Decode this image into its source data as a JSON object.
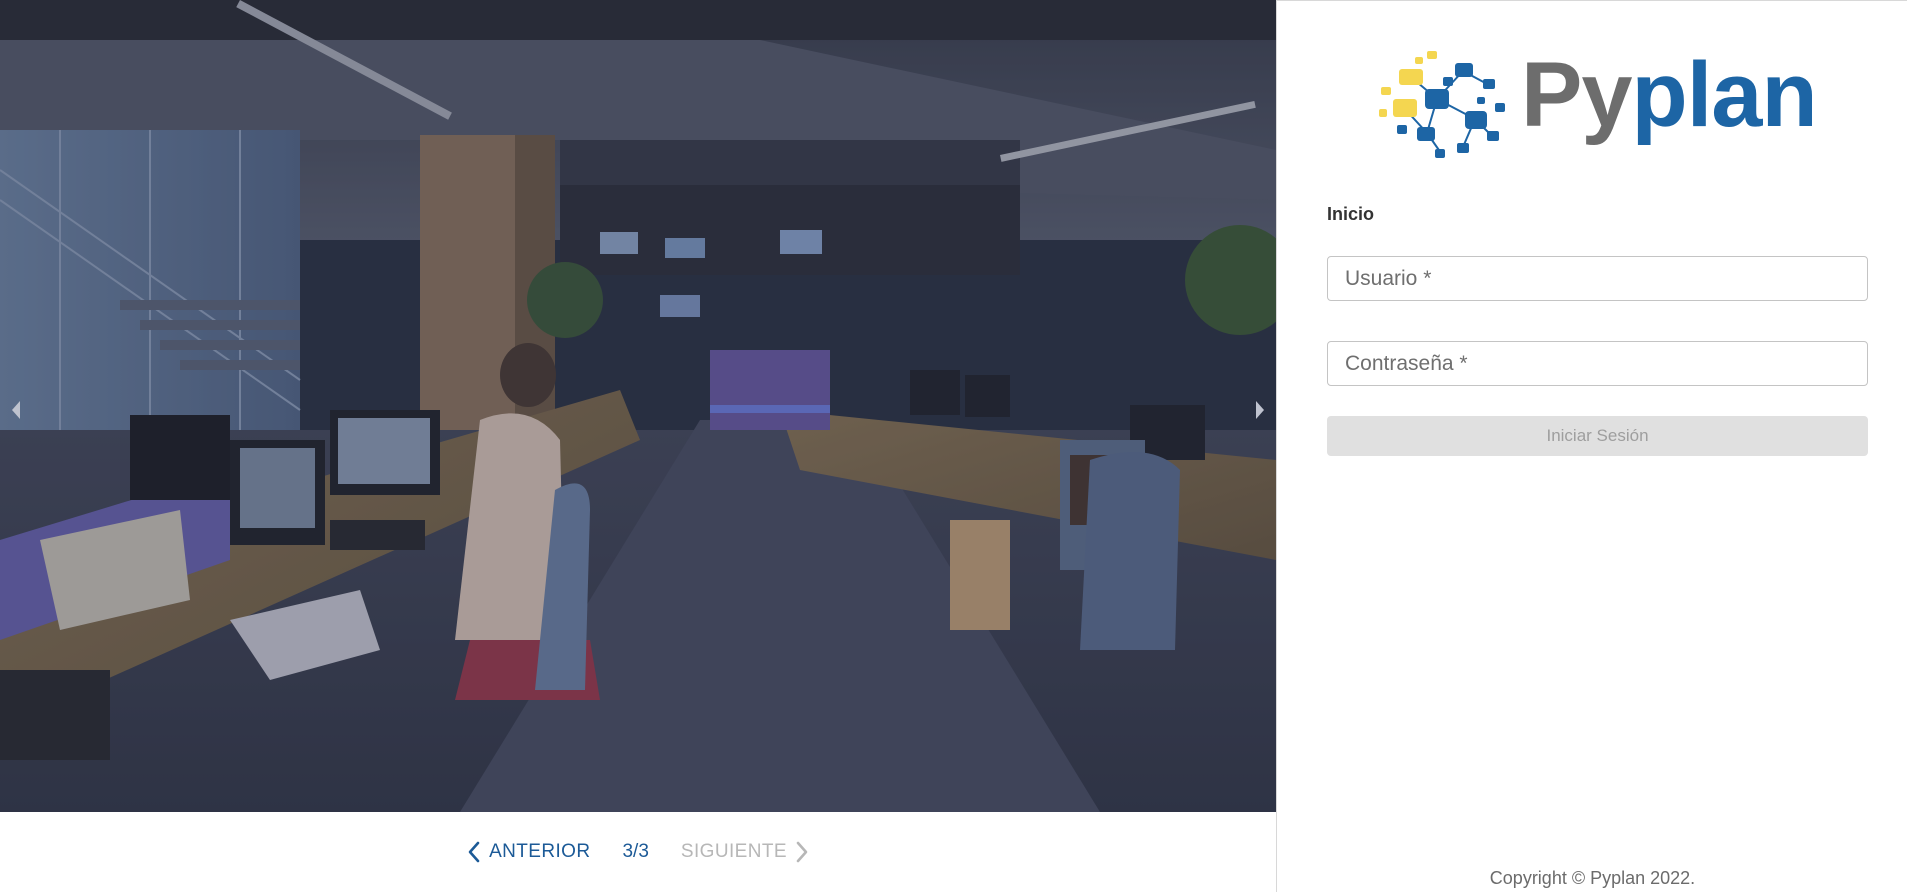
{
  "carousel": {
    "prev_label": "ANTERIOR",
    "next_label": "SIGUIENTE",
    "counter": "3/3",
    "current_slide": 3,
    "total_slides": 3,
    "image_subject": "office-workspace-photo"
  },
  "brand": {
    "name_part1": "Py",
    "name_part2": "plan",
    "logo_icon": "network-nodes-icon",
    "colors": {
      "gray": "#6d6d6d",
      "blue": "#1d65a5",
      "yellow": "#f4d650"
    }
  },
  "login": {
    "title": "Inicio",
    "username_placeholder": "Usuario *",
    "password_placeholder": "Contraseña *",
    "submit_label": "Iniciar Sesión",
    "submit_disabled": true
  },
  "footer": {
    "copyright": "Copyright © Pyplan 2022."
  },
  "colors": {
    "accent": "#1c5a97",
    "disabled_text": "#b7b7b7",
    "button_disabled_bg": "#e0e0e0"
  }
}
